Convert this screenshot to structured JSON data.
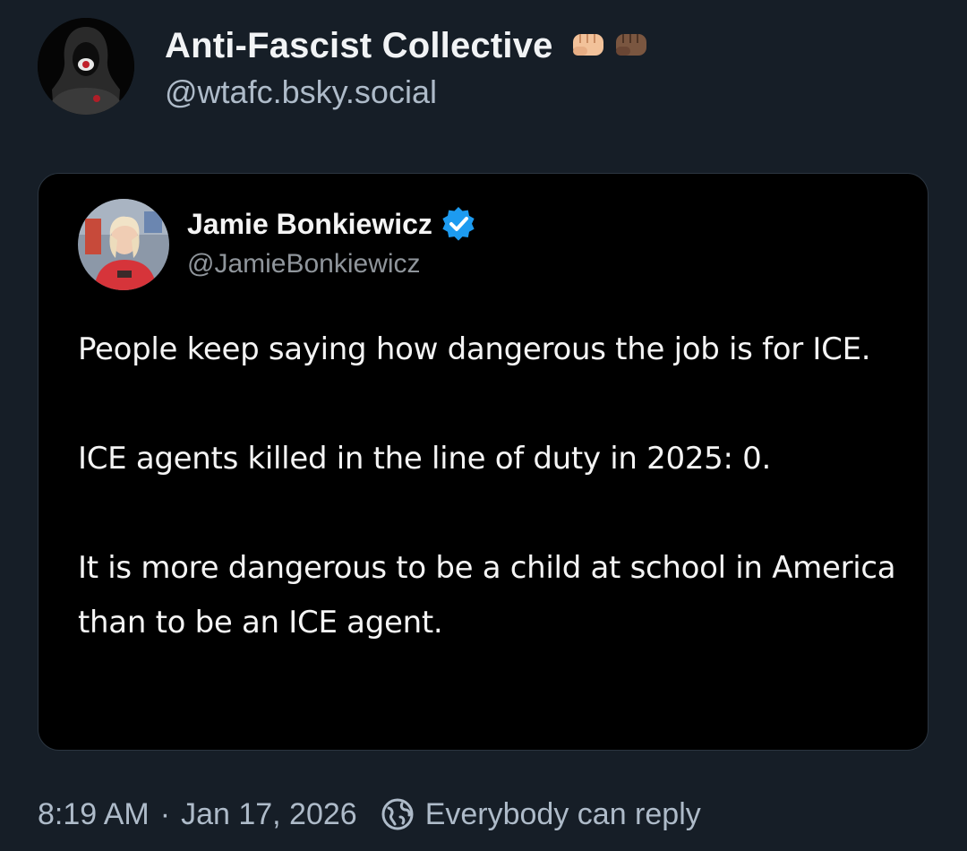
{
  "author": {
    "display_name": "Anti-Fascist Collective",
    "handle": "@wtafc.bsky.social",
    "name_suffix_icons": [
      "raised-fist-light-icon",
      "raised-fist-dark-icon"
    ]
  },
  "embed": {
    "author_name": "Jamie Bonkiewicz",
    "author_handle": "@JamieBonkiewicz",
    "verified": true,
    "paragraphs": [
      "People keep saying how dangerous the job is for ICE.",
      "ICE agents killed in the line of duty in 2025: 0.",
      "It is more dangerous to be a child at school in America than to be an ICE agent."
    ]
  },
  "footer": {
    "time": "8:19 AM",
    "separator": "·",
    "date": "Jan 17, 2026",
    "reply_setting": "Everybody can reply"
  },
  "colors": {
    "background": "#161e27",
    "card": "#000000",
    "muted_text": "#aebbc9",
    "verified_blue": "#1d9bf0"
  }
}
